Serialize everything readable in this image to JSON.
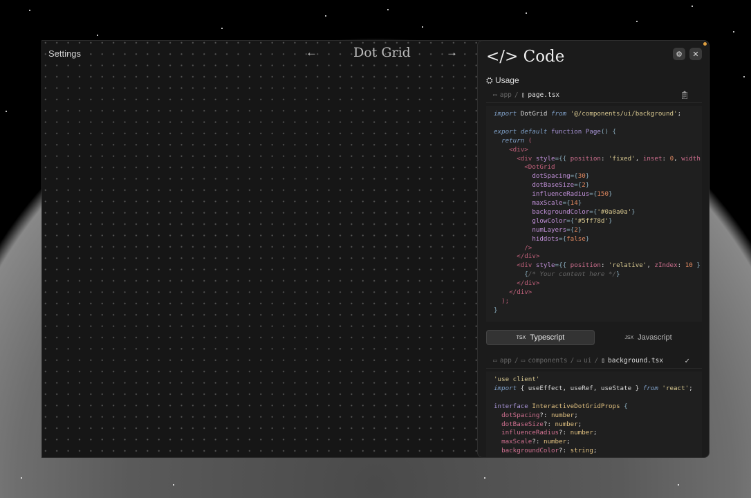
{
  "stage": {
    "settings": "Settings",
    "title": "Dot Grid",
    "prev": "←",
    "next": "→"
  },
  "panel": {
    "title": "</> Code",
    "settings_icon": "⚙",
    "close_icon": "✕",
    "usage": "Usage",
    "usage_path": {
      "dir": "app",
      "sep": "/",
      "file": "page.tsx"
    },
    "usage_code": [
      [
        [
          "kw",
          "import"
        ],
        [
          "pl",
          " DotGrid "
        ],
        [
          "kw",
          "from"
        ],
        [
          "str",
          " '@/components/ui/background'"
        ],
        [
          "pl",
          ";"
        ]
      ],
      [],
      [
        [
          "kw",
          "export default"
        ],
        [
          "fn",
          " function"
        ],
        [
          "fn",
          " Page"
        ],
        [
          "pn",
          "() {"
        ]
      ],
      [
        [
          "kw",
          "  return"
        ],
        [
          "tag",
          " ("
        ]
      ],
      [
        [
          "tag",
          "    <div>"
        ]
      ],
      [
        [
          "tag",
          "      <div"
        ],
        [
          "attr",
          " style"
        ],
        [
          "pn",
          "={{ "
        ],
        [
          "prop",
          "position"
        ],
        [
          "pl",
          ": "
        ],
        [
          "str",
          "'fixed'"
        ],
        [
          "pl",
          ", "
        ],
        [
          "prop",
          "inset"
        ],
        [
          "pl",
          ": "
        ],
        [
          "num",
          "0"
        ],
        [
          "pl",
          ", "
        ],
        [
          "prop",
          "width"
        ]
      ],
      [
        [
          "tag",
          "        <DotGrid"
        ]
      ],
      [
        [
          "attr",
          "          dotSpacing"
        ],
        [
          "pn",
          "={"
        ],
        [
          "num",
          "30"
        ],
        [
          "pn",
          "}"
        ]
      ],
      [
        [
          "attr",
          "          dotBaseSize"
        ],
        [
          "pn",
          "={"
        ],
        [
          "num",
          "2"
        ],
        [
          "pn",
          "}"
        ]
      ],
      [
        [
          "attr",
          "          influenceRadius"
        ],
        [
          "pn",
          "={"
        ],
        [
          "num",
          "150"
        ],
        [
          "pn",
          "}"
        ]
      ],
      [
        [
          "attr",
          "          maxScale"
        ],
        [
          "pn",
          "={"
        ],
        [
          "num",
          "14"
        ],
        [
          "pn",
          "}"
        ]
      ],
      [
        [
          "attr",
          "          backgroundColor"
        ],
        [
          "pn",
          "={"
        ],
        [
          "str",
          "'#0a0a0a'"
        ],
        [
          "pn",
          "}"
        ]
      ],
      [
        [
          "attr",
          "          glowColor"
        ],
        [
          "pn",
          "={"
        ],
        [
          "str",
          "'#5ff78d'"
        ],
        [
          "pn",
          "}"
        ]
      ],
      [
        [
          "attr",
          "          numLayers"
        ],
        [
          "pn",
          "={"
        ],
        [
          "num",
          "2"
        ],
        [
          "pn",
          "}"
        ]
      ],
      [
        [
          "attr",
          "          hiddots"
        ],
        [
          "pn",
          "={"
        ],
        [
          "num",
          "false"
        ],
        [
          "pn",
          "}"
        ]
      ],
      [
        [
          "tag",
          "        />"
        ]
      ],
      [
        [
          "tag",
          "      </div>"
        ]
      ],
      [
        [
          "tag",
          "      <div"
        ],
        [
          "attr",
          " style"
        ],
        [
          "pn",
          "={{ "
        ],
        [
          "prop",
          "position"
        ],
        [
          "pl",
          ": "
        ],
        [
          "str",
          "'relative'"
        ],
        [
          "pl",
          ", "
        ],
        [
          "prop",
          "zIndex"
        ],
        [
          "pl",
          ": "
        ],
        [
          "num",
          "10"
        ],
        [
          "pn",
          " }"
        ]
      ],
      [
        [
          "pn",
          "        {"
        ],
        [
          "cm",
          "/* Your content here */"
        ],
        [
          "pn",
          "}"
        ]
      ],
      [
        [
          "tag",
          "      </div>"
        ]
      ],
      [
        [
          "tag",
          "    </div>"
        ]
      ],
      [
        [
          "tag",
          "  );"
        ]
      ],
      [
        [
          "pn",
          "}"
        ]
      ]
    ],
    "tabs": [
      {
        "label": "Typescript",
        "icon": "TSX",
        "active": true
      },
      {
        "label": "Javascript",
        "icon": "JSX",
        "active": false
      }
    ],
    "source_path": {
      "dirs": [
        "app",
        "components",
        "ui"
      ],
      "sep": "/",
      "file": "background.tsx"
    },
    "source_code": [
      [
        [
          "str",
          "'use client'"
        ]
      ],
      [
        [
          "kw",
          "import"
        ],
        [
          "pl",
          " { useEffect, useRef, useState } "
        ],
        [
          "kw",
          "from"
        ],
        [
          "str",
          " 'react'"
        ],
        [
          "pl",
          ";"
        ]
      ],
      [],
      [
        [
          "fn",
          "interface"
        ],
        [
          "ty",
          " InteractiveDotGridProps"
        ],
        [
          "pn",
          " {"
        ]
      ],
      [
        [
          "prop",
          "  dotSpacing"
        ],
        [
          "pl",
          "?: "
        ],
        [
          "ty",
          "number"
        ],
        [
          "pl",
          ";"
        ]
      ],
      [
        [
          "prop",
          "  dotBaseSize"
        ],
        [
          "pl",
          "?: "
        ],
        [
          "ty",
          "number"
        ],
        [
          "pl",
          ";"
        ]
      ],
      [
        [
          "prop",
          "  influenceRadius"
        ],
        [
          "pl",
          "?: "
        ],
        [
          "ty",
          "number"
        ],
        [
          "pl",
          ";"
        ]
      ],
      [
        [
          "prop",
          "  maxScale"
        ],
        [
          "pl",
          "?: "
        ],
        [
          "ty",
          "number"
        ],
        [
          "pl",
          ";"
        ]
      ],
      [
        [
          "prop",
          "  backgroundColor"
        ],
        [
          "pl",
          "?: "
        ],
        [
          "ty",
          "string"
        ],
        [
          "pl",
          ";"
        ]
      ]
    ]
  }
}
